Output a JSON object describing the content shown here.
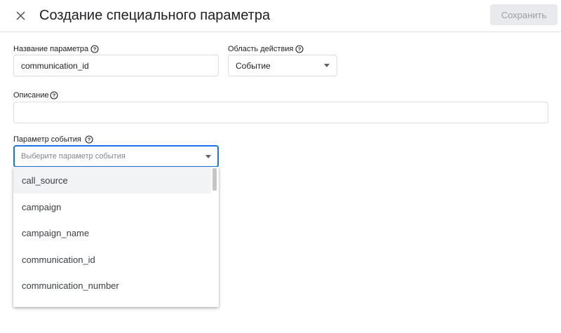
{
  "header": {
    "title": "Создание специального параметра",
    "save_label": "Сохранить"
  },
  "form": {
    "name_label": "Название параметра",
    "name_value": "communication_id",
    "scope_label": "Область действия",
    "scope_value": "Событие",
    "description_label": "Описание",
    "description_value": "",
    "event_param_label": "Параметр события",
    "event_param_placeholder": "Выберите параметр события"
  },
  "dropdown": {
    "items": [
      "call_source",
      "campaign",
      "campaign_name",
      "communication_id",
      "communication_number"
    ]
  },
  "colors": {
    "focus": "#1a73e8",
    "hover": "#f1f3f4",
    "border": "#dadce0"
  },
  "icons": {
    "close": "close-icon",
    "help": "help-circle-icon",
    "caret": "caret-down-icon"
  }
}
